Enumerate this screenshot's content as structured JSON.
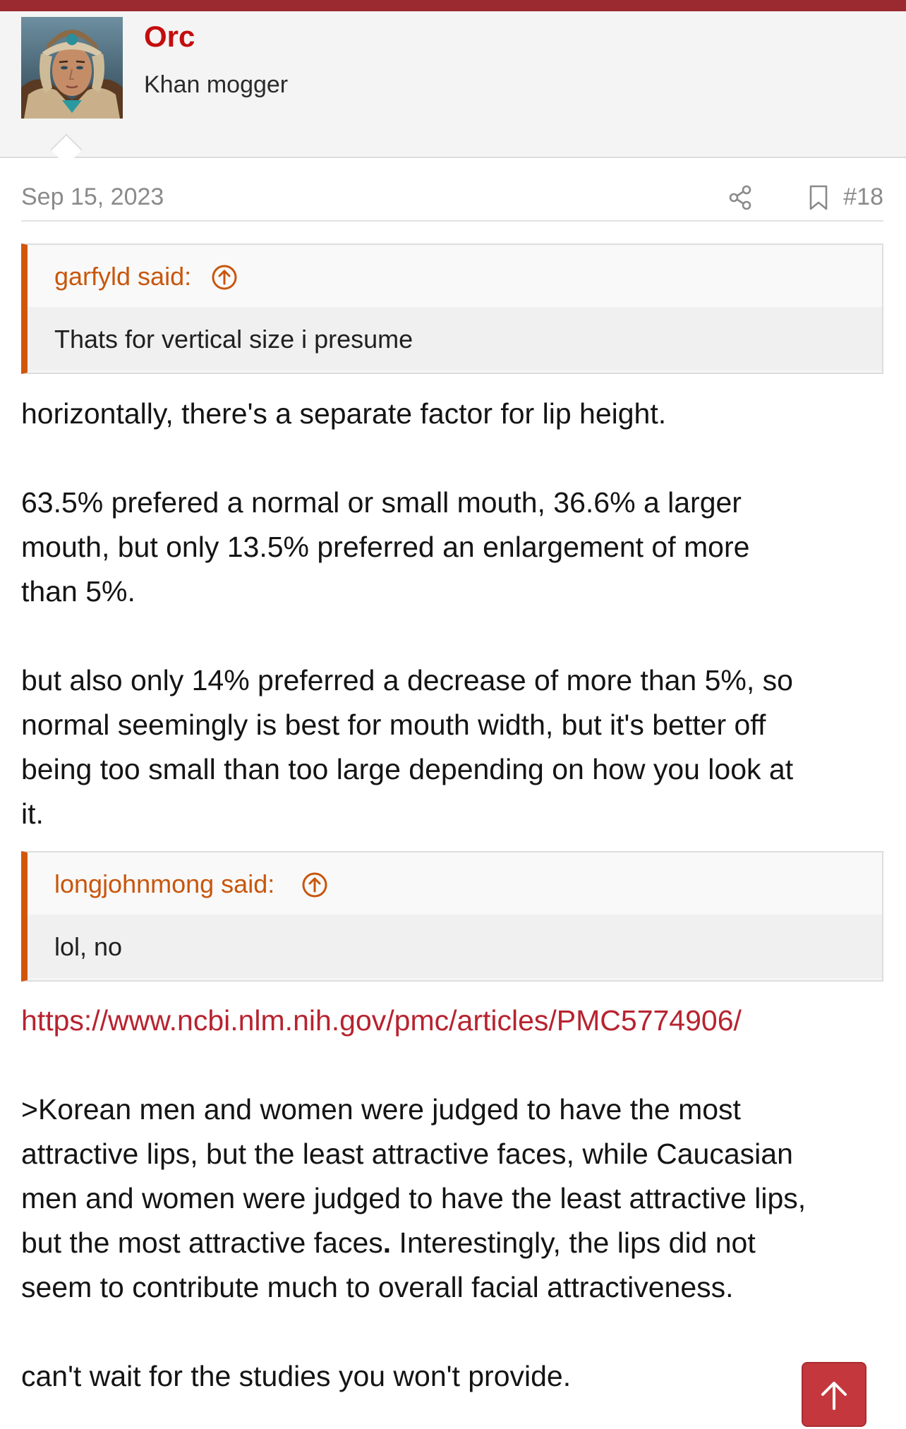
{
  "user": {
    "name": "Orc",
    "title": "Khan mogger"
  },
  "post": {
    "date": "Sep 15, 2023",
    "number": "#18"
  },
  "quote1": {
    "author": "garfyld said:",
    "text": "Thats for vertical size i presume"
  },
  "body1": {
    "p1": "horizontally, there's a separate factor for lip height.",
    "p2a": "63.5% prefered a normal or small mouth, 36.6% a larger",
    "p2b": "mouth, but only 13.5% preferred an enlargement of more",
    "p2c": "than 5%.",
    "p3a": "but also only 14% preferred a decrease of more than 5%, so",
    "p3b": "normal seemingly is best for mouth width, but it's better off",
    "p3c": "being too small than too large depending on how you look at",
    "p3d": "it."
  },
  "quote2": {
    "author": "longjohnmong said:",
    "text": "lol, no"
  },
  "body2": {
    "link": "https://www.ncbi.nlm.nih.gov/pmc/articles/PMC5774906/",
    "q1": ">Korean men and women were judged to have the most",
    "q2": "attractive lips, but the least attractive faces, while Caucasian",
    "q3": "men and women were judged to have the least attractive lips,",
    "q4a": "but the most attractive faces",
    "q4b": ".",
    "q4c": " Interestingly, the lips did not",
    "q5": "seem to contribute much to overall facial attractiveness.",
    "last": "can't wait for the studies you won't provide."
  },
  "icons": {
    "share": "share-icon",
    "bookmark": "bookmark-icon",
    "quote_up": "arrow-up-circle-icon",
    "scroll_top": "arrow-up-icon"
  },
  "colors": {
    "accent": "#9a2a2f",
    "username": "#c40d0d",
    "quote_border": "#d2560a",
    "link": "#b7232f"
  }
}
